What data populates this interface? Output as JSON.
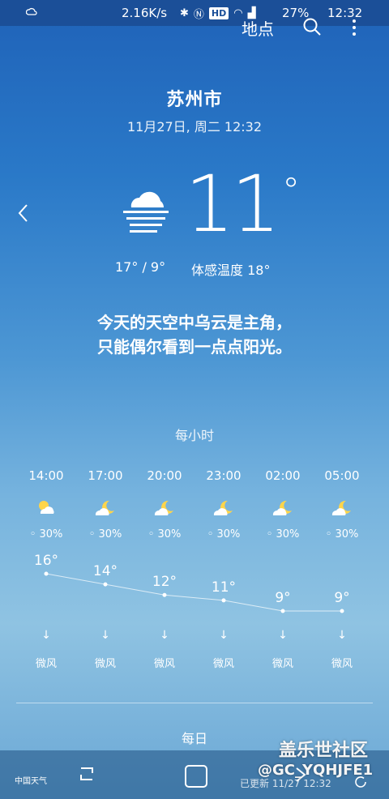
{
  "status": {
    "speed": "2.16K/s",
    "battery": "27%",
    "time": "12:32",
    "hd": "HD"
  },
  "header": {
    "place_label": "地点"
  },
  "current": {
    "city": "苏州市",
    "datetime": "11月27日, 周二 12:32",
    "temp": "11",
    "deg": "°",
    "range": "17° / 9°",
    "feels": "体感温度 18°",
    "description_line1": "今天的天空中乌云是主角，",
    "description_line2": "只能偶尔看到一点点阳光。"
  },
  "hourly": {
    "title": "每小时",
    "items": [
      {
        "time": "14:00",
        "precip": "30%",
        "temp": "16°",
        "wind": "微风",
        "icon": "partly-cloudy-day-icon",
        "temp_value": 16
      },
      {
        "time": "17:00",
        "precip": "30%",
        "temp": "14°",
        "wind": "微风",
        "icon": "partly-cloudy-night-icon",
        "temp_value": 14
      },
      {
        "time": "20:00",
        "precip": "30%",
        "temp": "12°",
        "wind": "微风",
        "icon": "partly-cloudy-night-icon",
        "temp_value": 12
      },
      {
        "time": "23:00",
        "precip": "30%",
        "temp": "11°",
        "wind": "微风",
        "icon": "partly-cloudy-night-icon",
        "temp_value": 11
      },
      {
        "time": "02:00",
        "precip": "30%",
        "temp": "9°",
        "wind": "微风",
        "icon": "partly-cloudy-night-icon",
        "temp_value": 9
      },
      {
        "time": "05:00",
        "precip": "30%",
        "temp": "9°",
        "wind": "微风",
        "icon": "partly-cloudy-night-icon",
        "temp_value": 9
      }
    ]
  },
  "daily": {
    "title": "每日"
  },
  "footer": {
    "logo": "中国天气",
    "updated": "已更新 11/27 12:32",
    "watermark1": "盖乐世社区",
    "watermark2": "@GC_YQHJFE1"
  }
}
